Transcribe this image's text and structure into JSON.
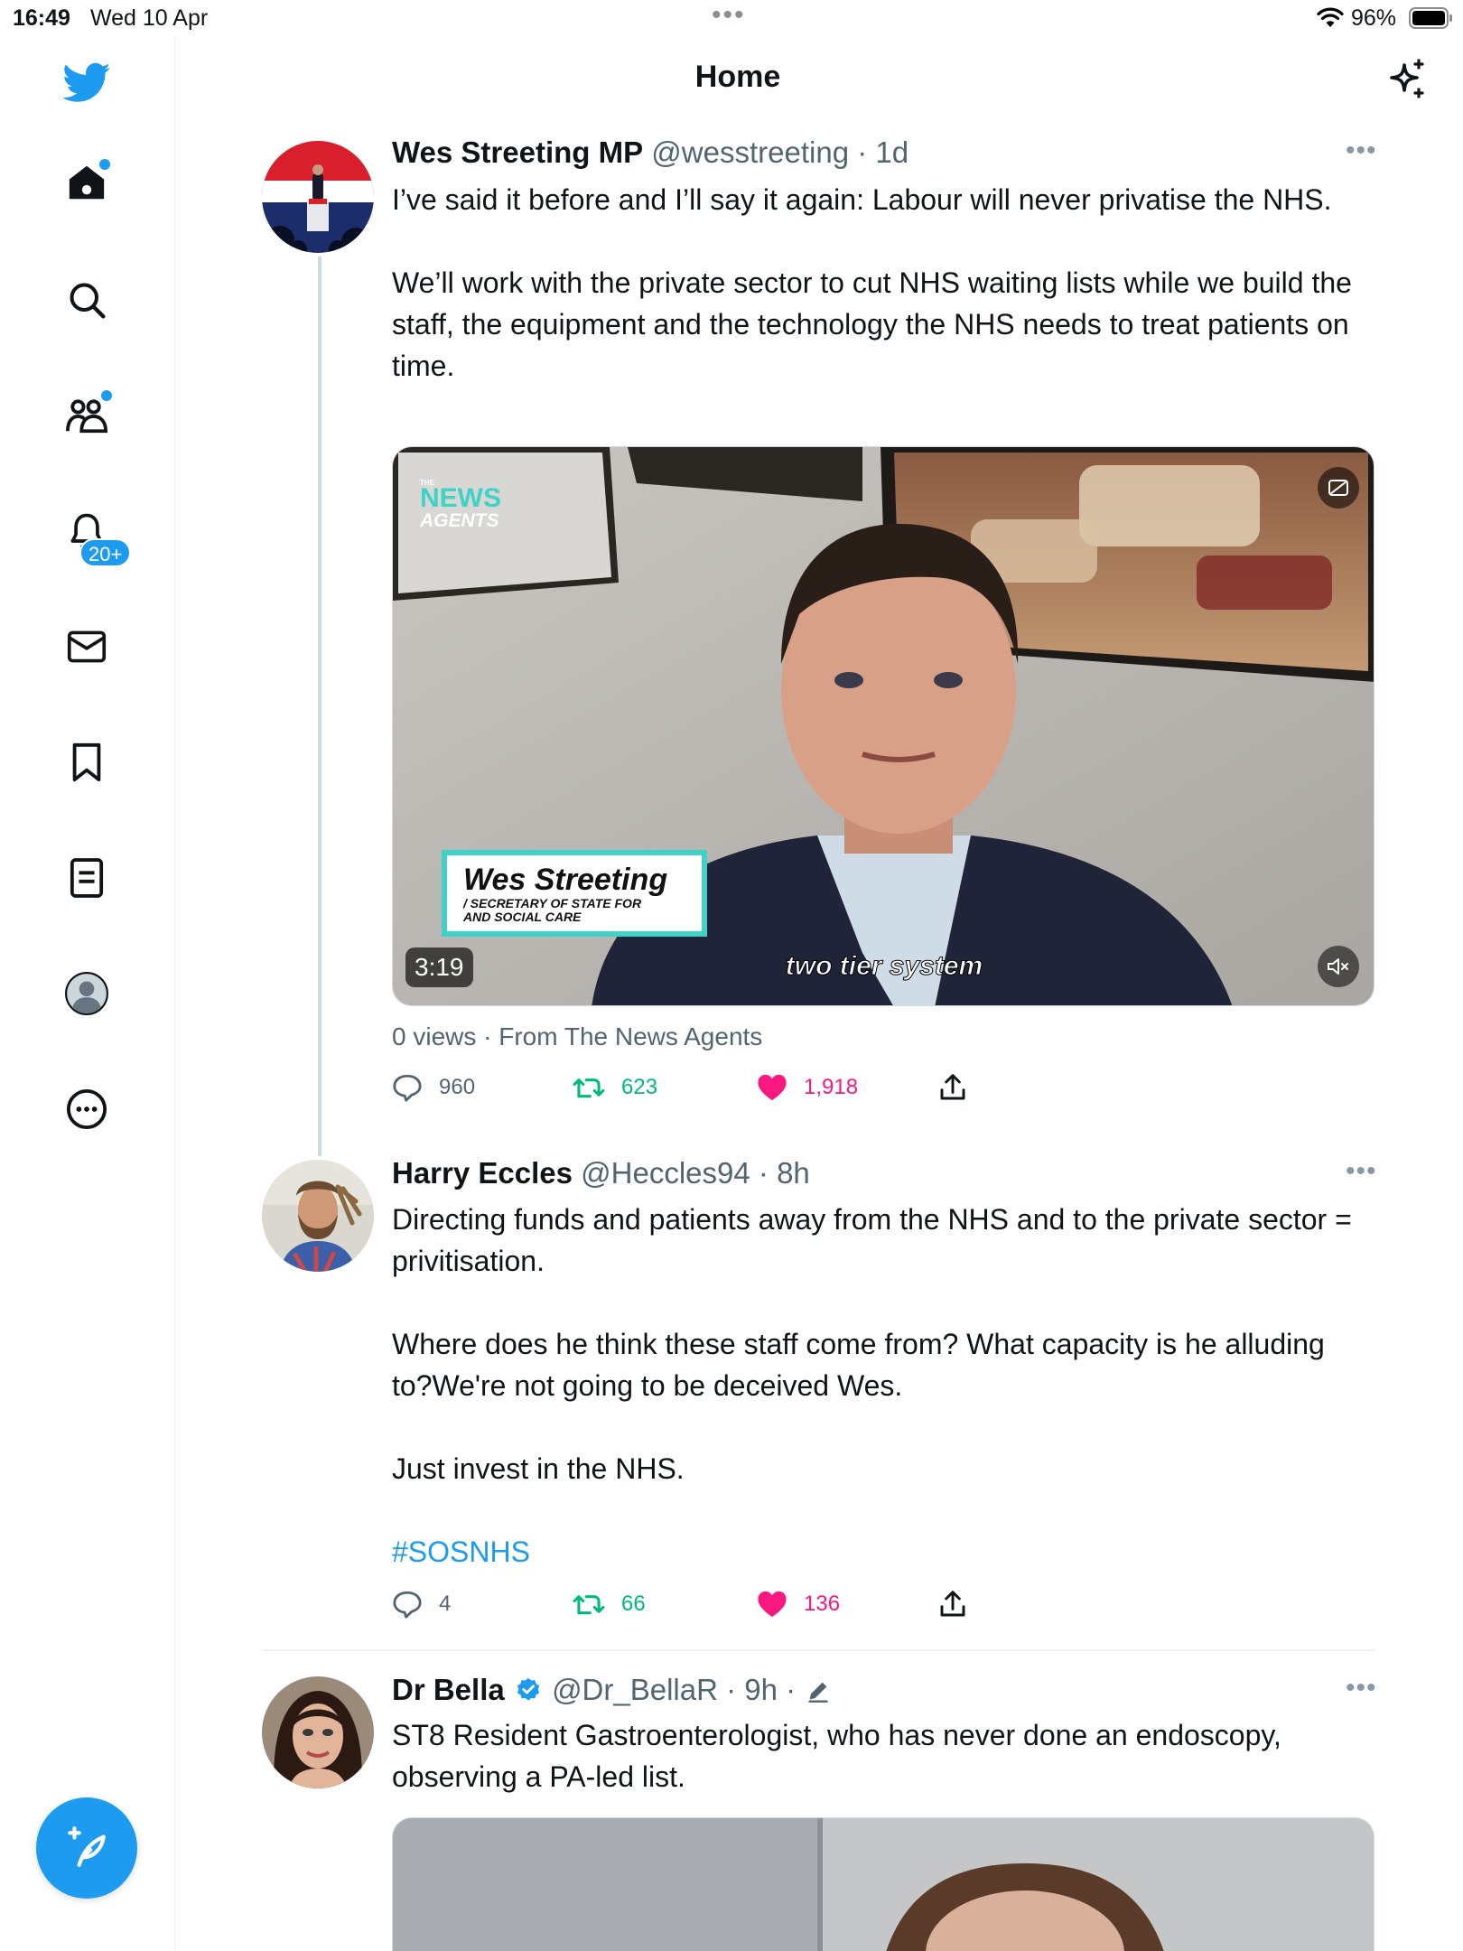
{
  "status_bar": {
    "time": "16:49",
    "date": "Wed 10 Apr",
    "battery": "96%"
  },
  "sidebar": {
    "items": [
      {
        "icon": "home-icon",
        "label": "Home"
      },
      {
        "icon": "search-icon",
        "label": "Explore"
      },
      {
        "icon": "communities-icon",
        "label": "Communities"
      },
      {
        "icon": "bell-icon",
        "label": "Notifications"
      },
      {
        "icon": "mail-icon",
        "label": "Messages"
      },
      {
        "icon": "bookmark-icon",
        "label": "Bookmarks"
      },
      {
        "icon": "lists-icon",
        "label": "Lists"
      },
      {
        "icon": "profile-icon",
        "label": "Profile"
      },
      {
        "icon": "more-icon",
        "label": "More"
      }
    ],
    "notifications_badge": "20+"
  },
  "header": {
    "title": "Home"
  },
  "colors": {
    "accent": "#1d9bf0",
    "retweet": "#00ba7c",
    "like": "#f91880",
    "muted": "#536471"
  },
  "tweets": [
    {
      "name": "Wes Streeting MP",
      "handle": "@wesstreeting",
      "time": "· 1d",
      "paragraphs": [
        "I’ve said it before and I’ll say it again: Labour will never privatise the NHS.",
        "We’ll work with the private sector to cut NHS waiting lists while we build the staff, the equipment and the technology the NHS needs to treat patients on time."
      ],
      "media": {
        "logo_top": "THE",
        "logo_main": "NEWS",
        "logo_sub": "AGENTS",
        "lower_third_name": "Wes Streeting",
        "lower_third_role_1": "/ SECRETARY OF STATE FOR",
        "lower_third_role_2": "AND SOCIAL CARE",
        "caption": "two tier system",
        "duration": "3:19"
      },
      "views": "0 views · From The News Agents",
      "replies": "960",
      "retweets": "623",
      "likes": "1,918"
    },
    {
      "name": "Harry Eccles",
      "handle": "@Heccles94",
      "time": "· 8h",
      "paragraphs": [
        "Directing funds and patients away from the NHS and to the private sector = privitisation.",
        "Where does he think these staff come from? What capacity is he alluding to?We're not going to be deceived Wes.",
        "Just invest in the NHS."
      ],
      "hashtag": "#SOSNHS",
      "replies": "4",
      "retweets": "66",
      "likes": "136"
    },
    {
      "name": "Dr Bella",
      "handle": "@Dr_BellaR",
      "time": "· 9h ·",
      "paragraphs": [
        "ST8 Resident Gastroenterologist, who has never done an endoscopy, observing a PA-led list."
      ]
    }
  ]
}
